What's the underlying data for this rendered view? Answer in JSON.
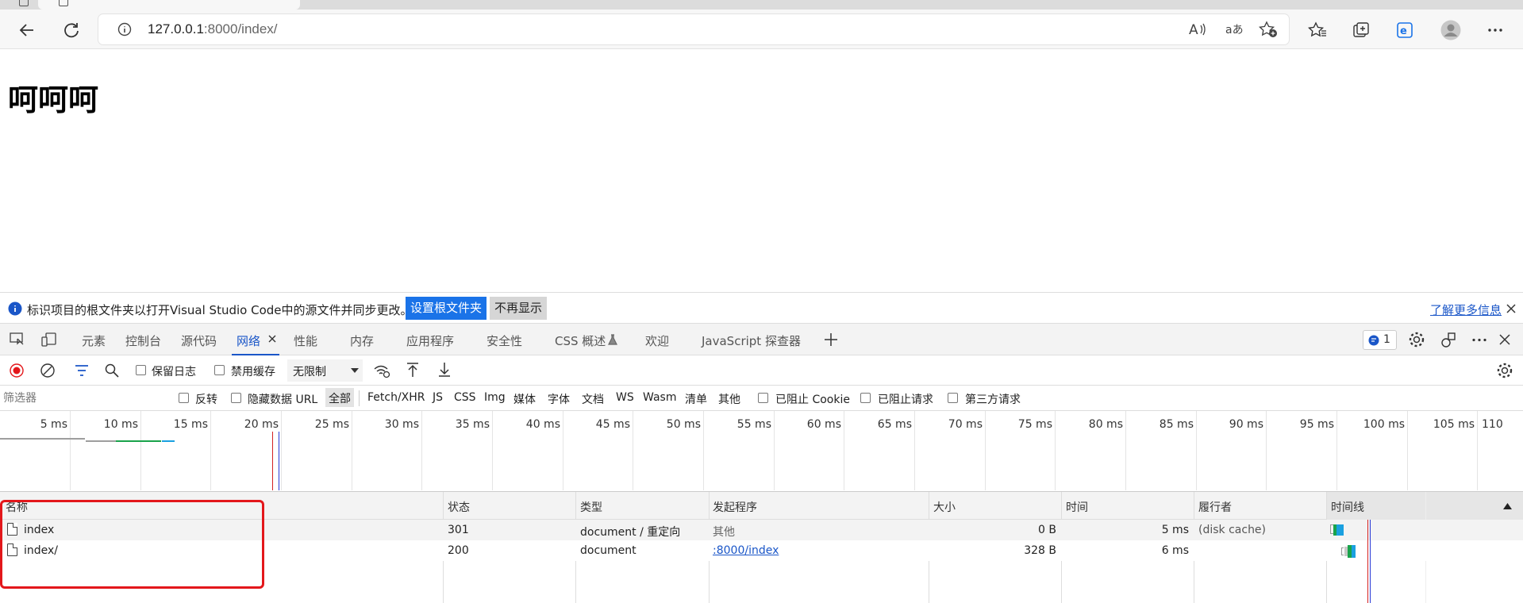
{
  "browser": {
    "url_host": "127.0.0.1",
    "url_rest": ":8000/index/"
  },
  "page": {
    "heading": "呵呵呵"
  },
  "infobar": {
    "message": "标识项目的根文件夹以打开Visual Studio Code中的源文件并同步更改。",
    "primary_button": "设置根文件夹",
    "secondary_button": "不再显示",
    "learn_more": "了解更多信息"
  },
  "devtools": {
    "tabs": [
      "元素",
      "控制台",
      "源代码",
      "网络",
      "性能",
      "内存",
      "应用程序",
      "安全性",
      "CSS 概述",
      "欢迎",
      "JavaScript 探查器"
    ],
    "active_tab": "网络",
    "issue_count": "1",
    "toolbar": {
      "preserve_log": "保留日志",
      "disable_cache": "禁用缓存",
      "throttle": "无限制"
    },
    "filter": {
      "placeholder": "筛选器",
      "invert": "反转",
      "hide_data_urls": "隐藏数据 URL",
      "types": [
        "全部",
        "Fetch/XHR",
        "JS",
        "CSS",
        "Img",
        "媒体",
        "字体",
        "文档",
        "WS",
        "Wasm",
        "清单",
        "其他"
      ],
      "active_type": "全部",
      "blocked_cookies": "已阻止 Cookie",
      "blocked_requests": "已阻止请求",
      "third_party": "第三方请求"
    },
    "timeline_ticks": [
      "5 ms",
      "10 ms",
      "15 ms",
      "20 ms",
      "25 ms",
      "30 ms",
      "35 ms",
      "40 ms",
      "45 ms",
      "50 ms",
      "55 ms",
      "60 ms",
      "65 ms",
      "70 ms",
      "75 ms",
      "80 ms",
      "85 ms",
      "90 ms",
      "95 ms",
      "100 ms",
      "105 ms",
      "110"
    ],
    "columns": [
      "名称",
      "状态",
      "类型",
      "发起程序",
      "大小",
      "时间",
      "履行者",
      "时间线"
    ],
    "rows": [
      {
        "name": "index",
        "status": "301",
        "type": "document / 重定向",
        "initiator": "其他",
        "size": "0 B",
        "time": "5 ms",
        "fulfilled_by": "(disk cache)"
      },
      {
        "name": "index/",
        "status": "200",
        "type": "document",
        "initiator": ":8000/index",
        "size": "328 B",
        "time": "6 ms",
        "fulfilled_by": ""
      }
    ]
  },
  "colors": {
    "accent": "#1a73e8",
    "highlight_box": "#e3171b",
    "record_red": "#e3171b"
  }
}
